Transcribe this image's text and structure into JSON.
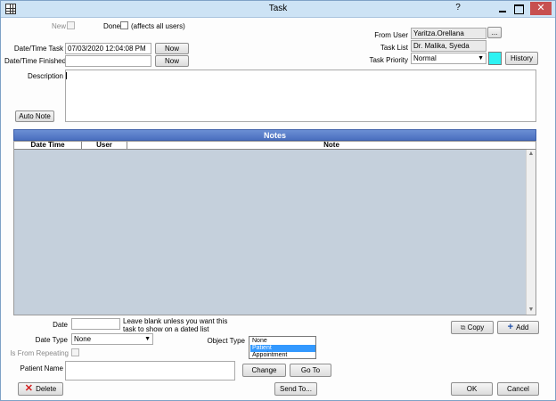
{
  "window": {
    "title": "Task"
  },
  "titlebar": {
    "help": "?",
    "close": "✕"
  },
  "top": {
    "new_label": "New",
    "done_label": "Done",
    "done_note": "(affects all users)",
    "datetime_task_label": "Date/Time Task",
    "datetime_task_value": "07/03/2020 12:04:08 PM",
    "datetime_finished_label": "Date/Time Finished",
    "datetime_finished_value": "",
    "now_label": "Now",
    "from_user_label": "From User",
    "from_user_value": "Yaritza.Orellana",
    "from_user_button": "...",
    "task_list_label": "Task List",
    "task_list_value": "Dr. Malika, Syeda",
    "task_priority_label": "Task Priority",
    "task_priority_value": "Normal",
    "priority_color": "#2ef2f2",
    "history_label": "History",
    "description_label": "Description",
    "auto_note_label": "Auto Note",
    "description_value": ""
  },
  "notes": {
    "title": "Notes",
    "columns": [
      "Date Time",
      "User",
      "Note"
    ]
  },
  "bottom": {
    "date_label": "Date",
    "date_value": "",
    "date_hint": "Leave blank unless you want this task to show on a dated list",
    "copy_label": "Copy",
    "add_label": "Add",
    "date_type_label": "Date Type",
    "date_type_value": "None",
    "object_type_label": "Object Type",
    "object_types": [
      "None",
      "Patient",
      "Appointment"
    ],
    "object_type_selected": "Patient",
    "is_from_repeating_label": "Is From Repeating",
    "patient_name_label": "Patient Name",
    "patient_name_value": "",
    "change_label": "Change",
    "goto_label": "Go To",
    "delete_label": "Delete",
    "sendto_label": "Send To...",
    "ok_label": "OK",
    "cancel_label": "Cancel"
  }
}
